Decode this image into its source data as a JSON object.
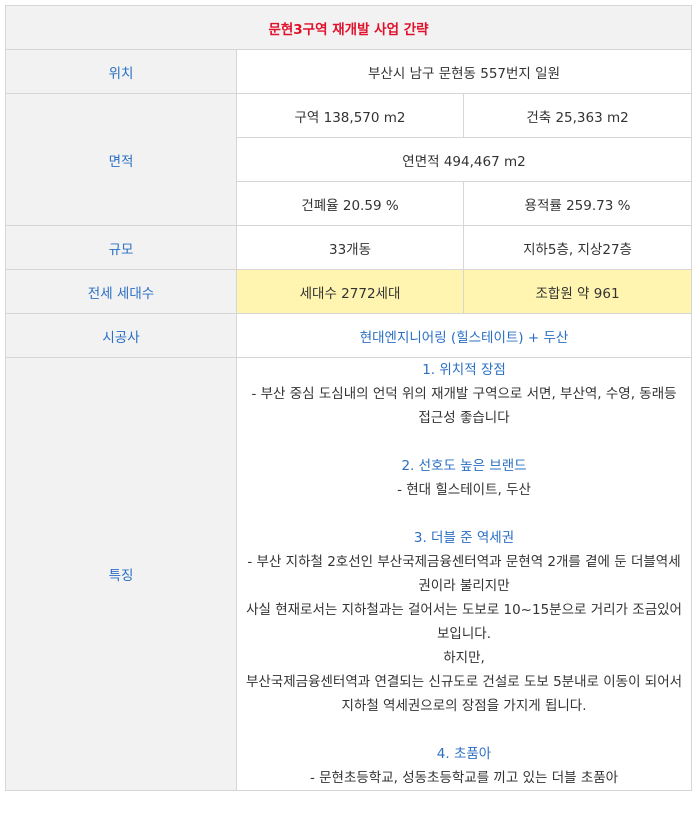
{
  "title": "문현3구역 재개발 사업 간략",
  "rows": {
    "location": {
      "label": "위치",
      "value": "부산시 남구 문현동 557번지 일원"
    },
    "area": {
      "label": "면적",
      "zone": "구역 138,570 m2",
      "building": "건축 25,363 m2",
      "total_floor": "연면적 494,467 m2",
      "coverage": "건폐율 20.59 %",
      "floor_ratio": "용적률 259.73 %"
    },
    "scale": {
      "label": "규모",
      "buildings": "33개동",
      "floors": "지하5층, 지상27층"
    },
    "households": {
      "label": "전세 세대수",
      "households": "세대수 2772세대",
      "members": "조합원 약 961"
    },
    "builder": {
      "label": "시공사",
      "value": "현대엔지니어링 (힐스테이트) + 두산"
    },
    "features": {
      "label": "특징",
      "blocks": [
        {
          "heading": "1. 위치적 장점",
          "lines": [
            "- 부산 중심 도심내의 언덕 위의 재개발 구역으로 서면, 부산역, 수영, 동래등 접근성 좋습니다"
          ]
        },
        {
          "heading": "2. 선호도 높은 브랜드",
          "lines": [
            "- 현대 힐스테이트, 두산"
          ]
        },
        {
          "heading": "3. 더블 준 역세권",
          "lines": [
            "- 부산 지하철 2호선인 부산국제금융센터역과 문현역 2개를 곁에 둔 더블역세권이라 불리지만",
            "사실 현재로서는 지하철과는 걸어서는 도보로 10~15분으로 거리가 조금있어보입니다.",
            "하지만,",
            "부산국제금융센터역과 연결되는 신규도로 건설로 도보 5분내로 이동이 되어서 지하철 역세권으로의 장점을 가지게 됩니다."
          ]
        },
        {
          "heading": "4. 초품아",
          "lines": [
            "- 문현초등학교, 성동초등학교를 끼고 있는 더블 초품아"
          ]
        }
      ]
    }
  }
}
